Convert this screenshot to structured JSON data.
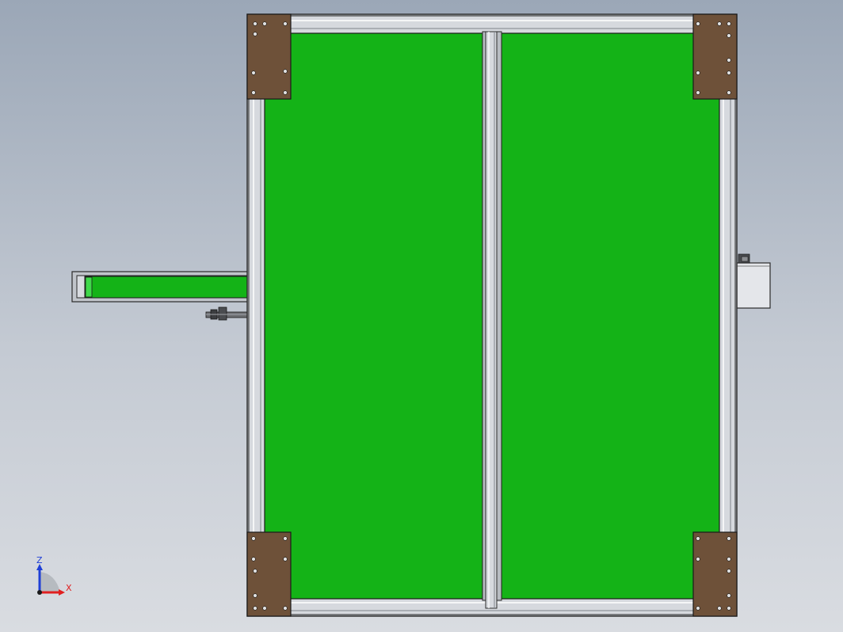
{
  "viewport": {
    "background_top": "#9ba7b7",
    "background_bottom": "#d9dce1"
  },
  "model": {
    "panel_color": "#14b317",
    "frame_color": "#b8bcc2",
    "frame_edge_color": "#2a2a2a",
    "bracket_color": "#6e5139",
    "screw_color": "#e0e0e0"
  },
  "triad": {
    "z_label": "Z",
    "x_label": "X",
    "z_color": "#1f3fd6",
    "x_color": "#e02020"
  }
}
